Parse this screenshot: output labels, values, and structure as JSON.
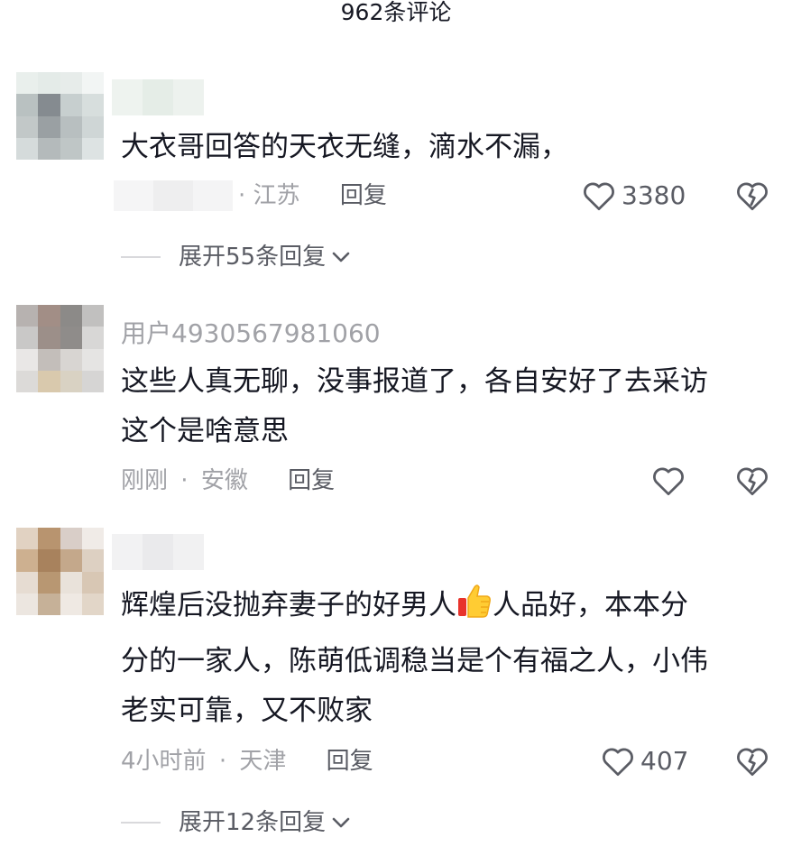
{
  "header": {
    "title": "962条评论"
  },
  "comments": [
    {
      "username": "",
      "text_lines": [
        "大衣哥回答的天衣无缝，滴水不漏，"
      ],
      "time": "",
      "location": "江苏",
      "reply_label": "回复",
      "likes": "3380",
      "expand_label": "展开55条回复"
    },
    {
      "username": "用户4930567981060",
      "text_lines": [
        "这些人真无聊，没事报道了，各自安好了去采访",
        "这个是啥意思"
      ],
      "time": "刚刚",
      "location": "安徽",
      "reply_label": "回复",
      "likes": ""
    },
    {
      "username": "",
      "text_before_emoji": "辉煌后没抛弃妻子的好男人",
      "text_after_emoji": "人品好，本本分",
      "text_lines": [
        "分的一家人，陈萌低调稳当是个有福之人，小伟",
        "老实可靠，又不败家"
      ],
      "emoji": "thumbs-up",
      "time": "4小时前",
      "location": "天津",
      "reply_label": "回复",
      "likes": "407",
      "expand_label": "展开12条回复"
    }
  ],
  "separator": "·",
  "colors": {
    "text": "#161823",
    "meta": "#a1a2a7",
    "action": "#5a5c64",
    "divider": "#d9d9dc"
  },
  "icons": [
    "heart-icon",
    "heart-broken-icon",
    "chevron-down-icon"
  ]
}
